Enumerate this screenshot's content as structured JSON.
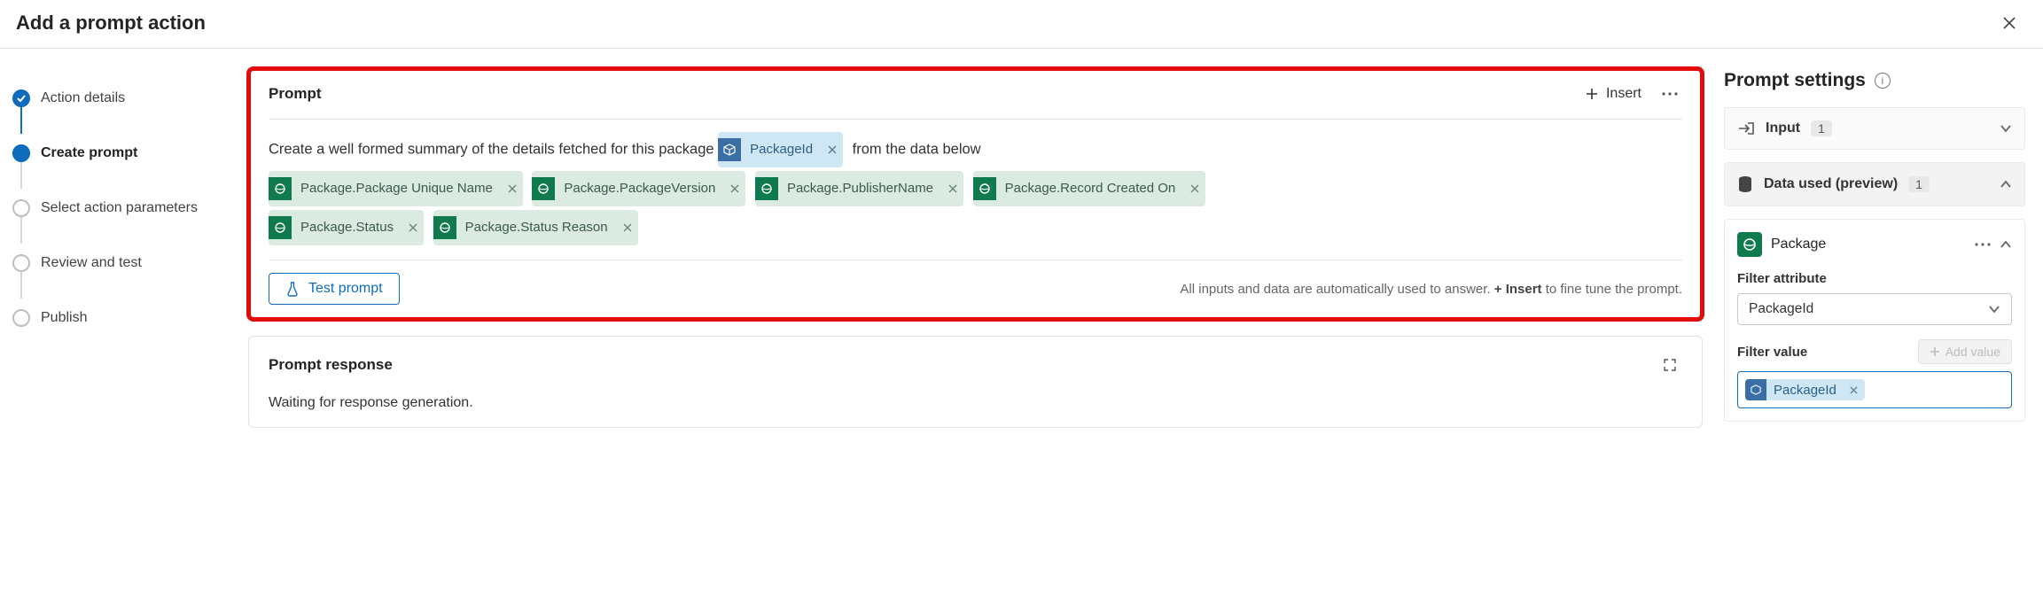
{
  "header": {
    "title": "Add a prompt action"
  },
  "steps": [
    {
      "label": "Action details",
      "state": "done"
    },
    {
      "label": "Create prompt",
      "state": "active"
    },
    {
      "label": "Select action parameters",
      "state": "pending"
    },
    {
      "label": "Review and test",
      "state": "pending"
    },
    {
      "label": "Publish",
      "state": "pending"
    }
  ],
  "prompt": {
    "title": "Prompt",
    "insert_label": "Insert",
    "text_pre": "Create a well formed summary of the details fetched for this package",
    "inline_param": "PackageId",
    "text_post": "from the data below",
    "fields": [
      "Package.Package Unique Name",
      "Package.PackageVersion",
      "Package.PublisherName",
      "Package.Record Created On",
      "Package.Status",
      "Package.Status Reason"
    ],
    "test_label": "Test prompt",
    "footer_hint_pre": "All inputs and data are automatically used to answer. ",
    "footer_hint_bold": "+ Insert",
    "footer_hint_post": " to fine tune the prompt."
  },
  "response": {
    "title": "Prompt response",
    "status": "Waiting for response generation."
  },
  "settings": {
    "title": "Prompt settings",
    "input_label": "Input",
    "input_count": "1",
    "data_used_label": "Data used (preview)",
    "data_used_count": "1",
    "entity": {
      "name": "Package",
      "filter_attr_label": "Filter attribute",
      "filter_attr_value": "PackageId",
      "filter_value_label": "Filter value",
      "add_value_label": "Add value",
      "filter_value_chip": "PackageId"
    }
  }
}
